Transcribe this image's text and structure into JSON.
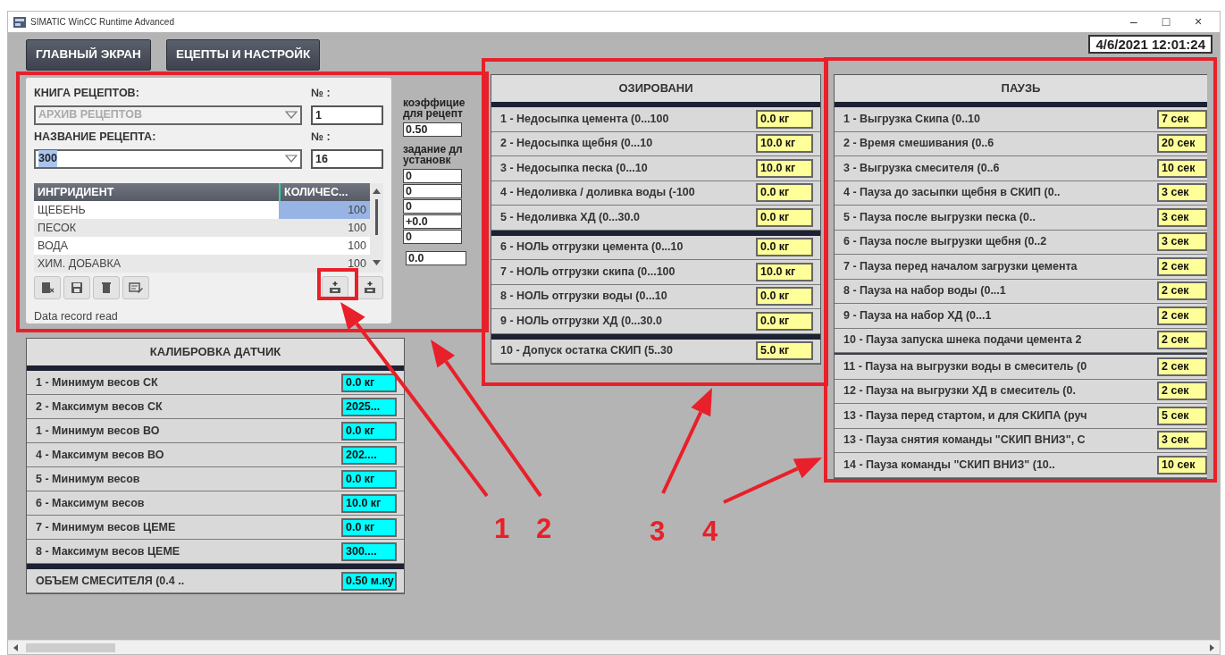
{
  "window": {
    "title": "SIMATIC WinCC Runtime Advanced",
    "controls": [
      "–",
      "□",
      "×"
    ]
  },
  "nav_buttons": [
    {
      "label": "ГЛАВНЫЙ ЭКРАН"
    },
    {
      "label": "ЕЦЕПТЫ И НАСТРОЙК"
    }
  ],
  "datetime": "4/6/2021 12:01:24",
  "recipe_view": {
    "book_label": "КНИГА РЕЦЕПТОВ:",
    "book_value": "АРХИВ РЕЦЕПТОВ",
    "book_disabled": true,
    "book_number_label": "№ :",
    "book_number": "1",
    "name_label": "НАЗВАНИЕ РЕЦЕПТА:",
    "name_value": "300",
    "name_number_label": "№ :",
    "name_number": "16",
    "columns": [
      "ИНГРИДИЕНТ",
      "КОЛИЧЕС..."
    ],
    "rows": [
      {
        "name": "ЩЕБЕНЬ",
        "qty": "100",
        "selected": true
      },
      {
        "name": "ПЕСОК",
        "qty": "100",
        "selected": false
      },
      {
        "name": "ВОДА",
        "qty": "100",
        "selected": false
      },
      {
        "name": "ХИМ. ДОБАВКА",
        "qty": "100",
        "selected": false
      }
    ],
    "status": "Data record read"
  },
  "coefficients": {
    "coef_label": [
      "коэффицие",
      "для рецепт"
    ],
    "coef_value": "0.50",
    "task_label": [
      "задание дл",
      "установк"
    ],
    "task_values": [
      "0",
      "0",
      "0",
      "+0.0",
      "0"
    ],
    "total": "0.0"
  },
  "dosing": {
    "title": "ОЗИРОВАНИ",
    "groups": [
      {
        "rows": [
          {
            "label": "1 - Недосыпка цемента (0...100",
            "value": "0.0 кг"
          },
          {
            "label": "2 - Недосыпка щебня (0...10",
            "value": "10.0 кг"
          },
          {
            "label": "3 - Недосыпка песка (0...10",
            "value": "10.0 кг"
          },
          {
            "label": "4 - Недоливка / доливка воды (-100",
            "value": "0.0 кг"
          },
          {
            "label": "5 - Недоливка ХД (0...30.0",
            "value": "0.0 кг"
          }
        ]
      },
      {
        "rows": [
          {
            "label": "6 - НОЛЬ отгрузки цемента  (0...10",
            "value": "0.0 кг"
          },
          {
            "label": "7 - НОЛЬ отгрузки скипа  (0...100",
            "value": "10.0 кг"
          },
          {
            "label": "8 - НОЛЬ отгрузки воды  (0...10",
            "value": "0.0 кг"
          },
          {
            "label": "9 - НОЛЬ отгрузки ХД  (0...30.0",
            "value": "0.0 кг"
          }
        ]
      },
      {
        "rows": [
          {
            "label": "10 - Допуск остатка СКИП (5..30",
            "value": "5.0 кг"
          }
        ]
      }
    ]
  },
  "pauses": {
    "title": "ПАУЗЬ",
    "groups": [
      {
        "rows": [
          {
            "label": "1 - Выгрузка Скипа (0..10",
            "value": "7 сек"
          },
          {
            "label": "2 - Время смешивания (0..6",
            "value": "20 сек"
          },
          {
            "label": "3 - Выгрузка смесителя (0..6",
            "value": "10 сек"
          },
          {
            "label": "4 - Пауза до засыпки щебня в СКИП (0..",
            "value": "3 сек"
          },
          {
            "label": "5 - Пауза после выгрузки песка (0..",
            "value": "3 сек"
          },
          {
            "label": "6 - Пауза после выгрузки щебня  (0..2",
            "value": "3 сек"
          },
          {
            "label": "7 - Пауза перед началом загрузки цемента",
            "value": "2 сек"
          },
          {
            "label": "8 - Пауза на набор воды  (0...1",
            "value": "2 сек"
          },
          {
            "label": "9 -  Пауза на набор ХД  (0...1",
            "value": "2 сек"
          },
          {
            "label": "10 - Пауза запуска шнека подачи цемента 2",
            "value": "2 сек"
          }
        ]
      },
      {
        "rows": [
          {
            "label": "11 - Пауза на выгрузки воды в смеситель (0",
            "value": "2 сек"
          },
          {
            "label": "12 - Пауза на выгрузки ХД в смеситель (0.",
            "value": "2 сек"
          },
          {
            "label": "13 - Пауза перед стартом, и для СКИПА (руч",
            "value": "5 сек"
          },
          {
            "label": "13 - Пауза снятия команды \"СКИП ВНИЗ\", С",
            "value": "3 сек"
          },
          {
            "label": "14 - Пауза команды \"СКИП ВНИЗ\" (10..",
            "value": "10 сек"
          }
        ]
      }
    ]
  },
  "calibration": {
    "title": "КАЛИБРОВКА ДАТЧИК",
    "groups": [
      {
        "rows": [
          {
            "label": "1 - Минимум весов СК",
            "value": "0.0 кг"
          },
          {
            "label": "2 - Максимум весов СК",
            "value": "2025..."
          },
          {
            "label": "1 - Минимум весов ВО",
            "value": "0.0 кг"
          },
          {
            "label": "4 - Максимум весов ВО",
            "value": "202...."
          },
          {
            "label": "5 - Минимум весов",
            "value": "0.0 кг"
          },
          {
            "label": "6 - Максимум весов",
            "value": "10.0 кг"
          },
          {
            "label": "7 - Минимум весов ЦЕМЕ",
            "value": "0.0 кг"
          },
          {
            "label": "8 - Максимум весов ЦЕМЕ",
            "value": "300...."
          }
        ]
      },
      {
        "rows": [
          {
            "label": "ОБЪЕМ СМЕСИТЕЛЯ (0.4 ..",
            "value": "0.50 м.ку"
          }
        ]
      }
    ]
  },
  "annotations": [
    {
      "label": "1"
    },
    {
      "label": "2"
    },
    {
      "label": "3"
    },
    {
      "label": "4"
    }
  ]
}
